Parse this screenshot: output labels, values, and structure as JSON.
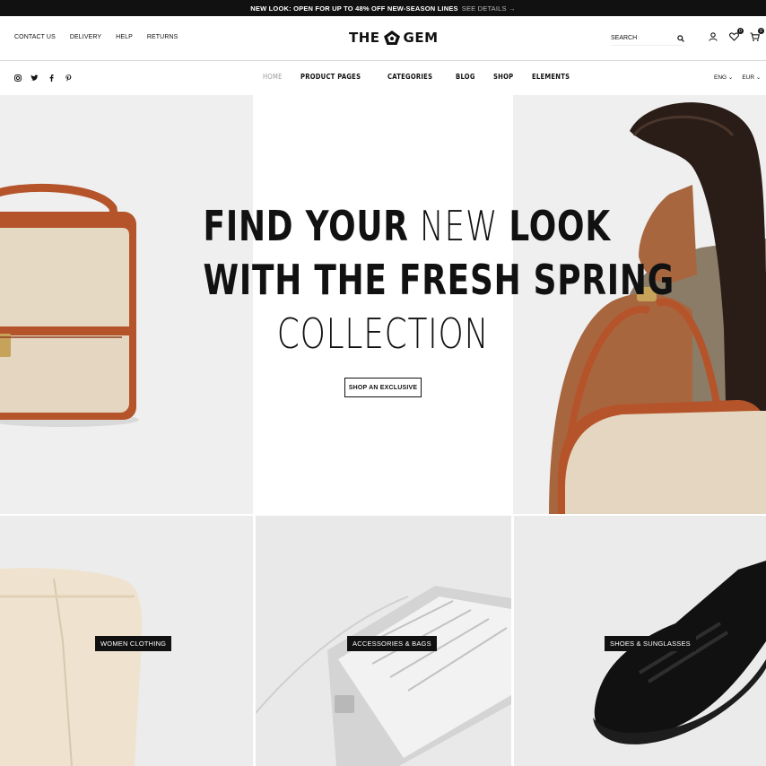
{
  "promo": {
    "text": "NEW LOOK: OPEN FOR UP TO 48% OFF NEW-SEASON LINES",
    "link": "SEE DETAILS →"
  },
  "header": {
    "links": [
      "CONTACT US",
      "DELIVERY",
      "HELP",
      "RETURNS"
    ],
    "logo_left": "THE",
    "logo_right": "GEM",
    "search_placeholder": "SEARCH",
    "wishlist_count": "0",
    "cart_count": "0"
  },
  "nav": {
    "social_icons": [
      "instagram-icon",
      "twitter-icon",
      "facebook-icon",
      "pinterest-icon"
    ],
    "menu": [
      "HOME",
      "PRODUCT PAGES",
      "CATEGORIES",
      "BLOG",
      "SHOP",
      "ELEMENTS"
    ],
    "active": "HOME",
    "language": "ENG",
    "currency": "EUR"
  },
  "hero": {
    "line1_bold1": "FIND YOUR",
    "line1_thin": "NEW",
    "line1_bold2": "LOOK",
    "line2": "WITH THE FRESH SPRING",
    "line3": "COLLECTION",
    "cta": "SHOP AN EXCLUSIVE"
  },
  "categories": [
    {
      "label": "WOMEN CLOTHING"
    },
    {
      "label": "ACCESSORIES & BAGS"
    },
    {
      "label": "SHOES & SUNGLASSES"
    }
  ],
  "colors": {
    "bag_leather": "#b5542a",
    "bag_canvas": "#e4d6c0",
    "skin": "#a8663f",
    "background_gray": "#efefef"
  }
}
